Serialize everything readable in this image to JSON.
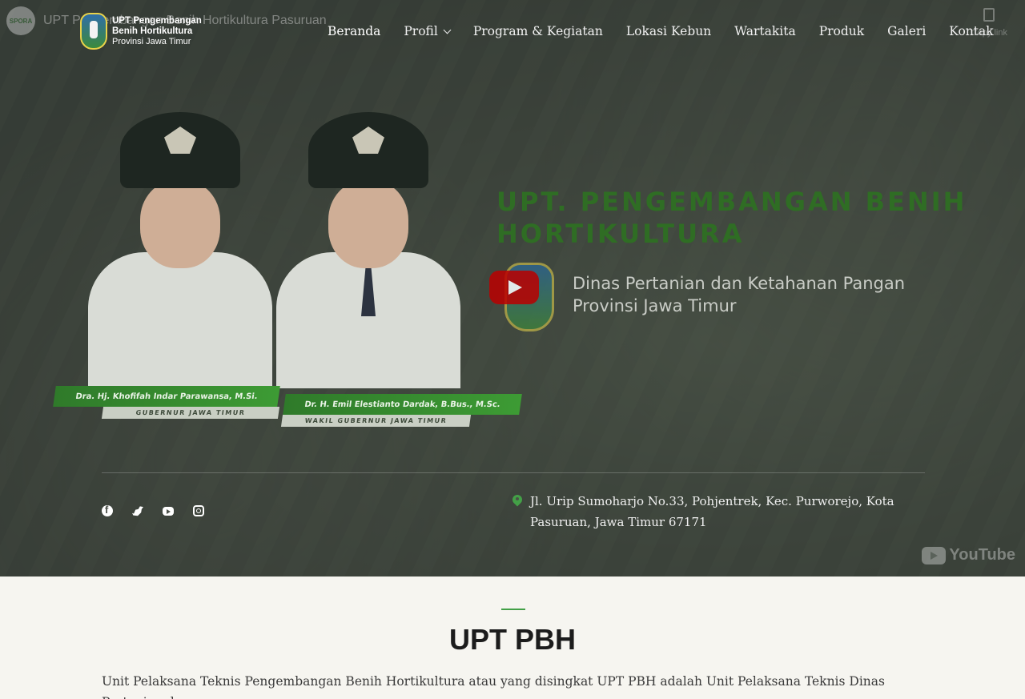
{
  "youtube": {
    "channel_avatar_text": "SPORA",
    "video_title": "UPT Pengembangan Benih Hortikultura Pasuruan",
    "copy_link": "Copy link",
    "logo_text": "YouTube"
  },
  "logo": {
    "line1": "UPT Pengembangan",
    "line2": "Benih Hortikultura",
    "line3": "Provinsi Jawa Timur"
  },
  "nav": {
    "items": [
      {
        "label": "Beranda"
      },
      {
        "label": "Profil"
      },
      {
        "label": "Program & Kegiatan"
      },
      {
        "label": "Lokasi Kebun"
      },
      {
        "label": "Wartakita"
      },
      {
        "label": "Produk"
      },
      {
        "label": "Galeri"
      },
      {
        "label": "Kontak"
      }
    ]
  },
  "video": {
    "title_line1": "UPT. PENGEMBANGAN BENIH",
    "title_line2": "HORTIKULTURA",
    "subtitle_line1": "Dinas Pertanian dan Ketahanan Pangan",
    "subtitle_line2": "Provinsi Jawa Timur",
    "person1_name": "Dra. Hj. Khofifah Indar Parawansa, M.Si.",
    "person1_role": "GUBERNUR JAWA TIMUR",
    "person2_name": "Dr. H. Emil Elestianto Dardak, B.Bus., M.Sc.",
    "person2_role": "WAKIL GUBERNUR JAWA TIMUR"
  },
  "contact": {
    "address": "Jl. Urip Sumoharjo No.33, Pohjentrek, Kec. Purworejo, Kota Pasuruan, Jawa Timur 67171"
  },
  "section": {
    "title": "UPT PBH",
    "body": "Unit Pelaksana Teknis Pengembangan Benih Hortikultura atau yang disingkat UPT PBH adalah Unit Pelaksana Teknis Dinas Pertanian dan"
  },
  "colors": {
    "accent": "#43a047",
    "title_green": "#2f6d24",
    "page_bg": "#f6f5f0"
  }
}
